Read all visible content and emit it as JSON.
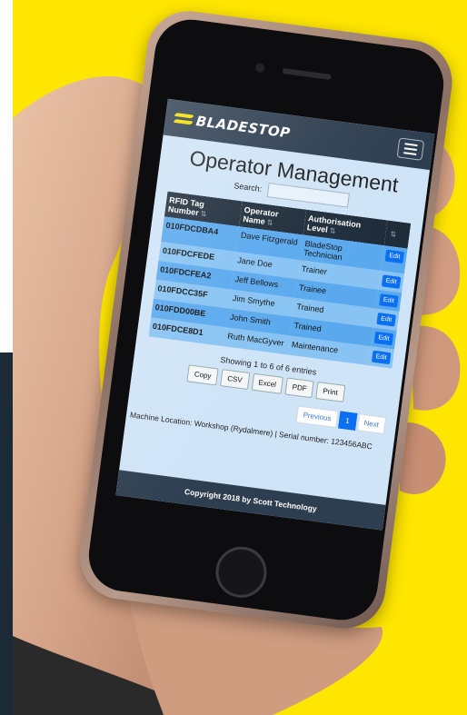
{
  "colors": {
    "background_yellow": "#ffe600",
    "navbar": "#2d3e50",
    "brand_accent": "#f6dc00",
    "row_odd": "#5aa9ee",
    "row_even": "#88c3f3",
    "button_blue": "#0a6ff0"
  },
  "app": {
    "brand": "BLADESTOP",
    "menu_icon": "hamburger-menu-icon",
    "page_title": "Operator Management",
    "search_label": "Search:",
    "search_value": ""
  },
  "table": {
    "headers": [
      "RFID Tag Number",
      "Operator Name",
      "Authorisation Level",
      ""
    ],
    "rows": [
      {
        "tag": "010FDCDBA4",
        "name": "Dave Fitzgerald",
        "level": "BladeStop Technician",
        "action": "Edit"
      },
      {
        "tag": "010FDCFEDE",
        "name": "Jane Doe",
        "level": "Trainer",
        "action": "Edit"
      },
      {
        "tag": "010FDCFEA2",
        "name": "Jeff Bellows",
        "level": "Trainee",
        "action": "Edit"
      },
      {
        "tag": "010FDCC35F",
        "name": "Jim Smythe",
        "level": "Trained",
        "action": "Edit"
      },
      {
        "tag": "010FDD00BE",
        "name": "John Smith",
        "level": "Trained",
        "action": "Edit"
      },
      {
        "tag": "010FDCE8D1",
        "name": "Ruth MacGyver",
        "level": "Maintenance",
        "action": "Edit"
      }
    ]
  },
  "info_text": "Showing 1 to 6 of 6 entries",
  "export_buttons": [
    "Copy",
    "CSV",
    "Excel",
    "PDF",
    "Print"
  ],
  "pager": {
    "previous": "Previous",
    "current": "1",
    "next": "Next"
  },
  "machine_info": "Machine Location: Workshop (Rydalmere) | Serial number: 123456ABC",
  "footer": "Copyright 2018 by Scott Technology"
}
